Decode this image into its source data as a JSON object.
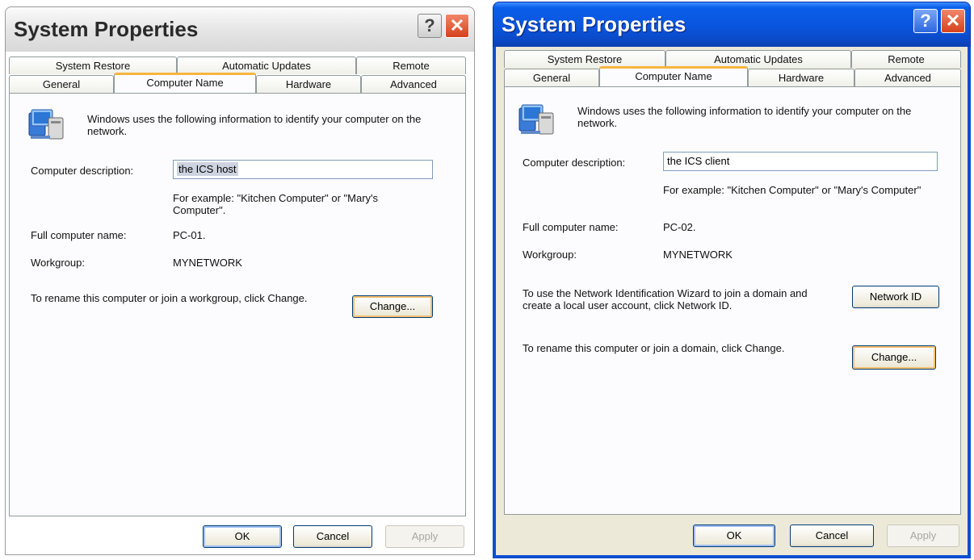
{
  "left_dialog": {
    "title": "System Properties",
    "tabs_back": [
      "System Restore",
      "Automatic Updates",
      "Remote"
    ],
    "tabs_front": [
      "General",
      "Computer Name",
      "Hardware",
      "Advanced"
    ],
    "active_tab": "Computer Name",
    "intro": "Windows uses the following information to identify your computer on the network.",
    "description_label": "Computer description:",
    "description_value": "the ICS host",
    "example_text": "For example: \"Kitchen Computer\" or \"Mary's Computer\".",
    "full_name_label": "Full computer name:",
    "full_name_value": "PC-01.",
    "workgroup_label": "Workgroup:",
    "workgroup_value": "MYNETWORK",
    "rename_text": "To rename this computer or join a workgroup, click Change.",
    "change_label": "Change...",
    "ok_label": "OK",
    "cancel_label": "Cancel",
    "apply_label": "Apply",
    "help_glyph": "?",
    "close_glyph": "✕"
  },
  "right_dialog": {
    "title": "System Properties",
    "tabs_back": [
      "System Restore",
      "Automatic Updates",
      "Remote"
    ],
    "tabs_front": [
      "General",
      "Computer Name",
      "Hardware",
      "Advanced"
    ],
    "active_tab": "Computer Name",
    "intro": "Windows uses the following information to identify your computer on the network.",
    "description_label": "Computer description:",
    "description_value": "the ICS client",
    "example_text": "For example: \"Kitchen Computer\" or \"Mary's Computer\"",
    "full_name_label": "Full computer name:",
    "full_name_value": "PC-02.",
    "workgroup_label": "Workgroup:",
    "workgroup_value": "MYNETWORK",
    "network_id_text": "To use the Network Identification Wizard to join a domain and create a local user account, click Network ID.",
    "network_id_label": "Network ID",
    "rename_text": "To rename this computer or join a domain, click Change.",
    "change_label": "Change...",
    "ok_label": "OK",
    "cancel_label": "Cancel",
    "apply_label": "Apply",
    "help_glyph": "?",
    "close_glyph": "✕"
  },
  "icons": {
    "computer": "computer-network-icon"
  },
  "colors": {
    "xp_blue": "#0a55de",
    "tab_highlight": "#f6b53f",
    "close_red": "#d6411c"
  }
}
